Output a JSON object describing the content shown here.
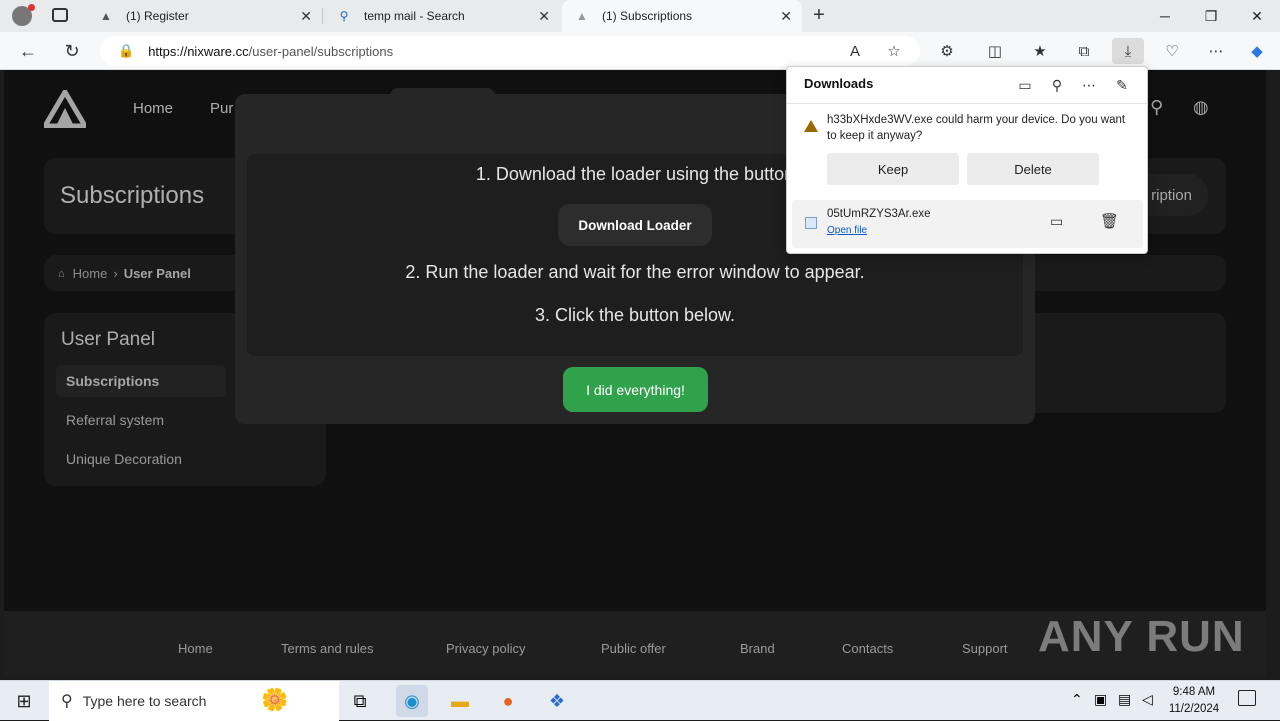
{
  "browser": {
    "tabs": [
      {
        "label": "(1) Register",
        "icon": "nixware-logo-icon"
      },
      {
        "label": "temp mail - Search",
        "icon": "search-icon"
      },
      {
        "label": "(1) Subscriptions",
        "icon": "nixware-logo-icon",
        "active": true
      }
    ],
    "url_host": "https://nixware.cc",
    "url_path": "/user-panel/subscriptions"
  },
  "site": {
    "nav": [
      "Home",
      "Pur"
    ],
    "page_title": "Subscriptions",
    "right_button_partial": "ription",
    "breadcrumb": {
      "home": "Home",
      "current": "User Panel"
    },
    "sidebar": {
      "title": "User Panel",
      "items": [
        "Subscriptions",
        "Referral system",
        "Unique Decoration"
      ]
    },
    "footer": [
      "Home",
      "Terms and rules",
      "Privacy policy",
      "Public offer",
      "Brand",
      "Contacts",
      "Support"
    ]
  },
  "modal": {
    "step1": "1. Download the loader using the button",
    "download_button": "Download Loader",
    "step2": "2. Run the loader and wait for the error window to appear.",
    "step3": "3. Click the button below.",
    "done_button": "I did everything!"
  },
  "downloads": {
    "title": "Downloads",
    "warning": "h33bXHxde3WV.exe could harm your device. Do you want to keep it anyway?",
    "keep": "Keep",
    "delete": "Delete",
    "file_name": "05tUmRZYS3Ar.exe",
    "open_file": "Open file"
  },
  "watermark": "ANY RUN",
  "taskbar": {
    "search_placeholder": "Type here to search",
    "time": "9:48 AM",
    "date": "11/2/2024"
  },
  "colors": {
    "accent_green": "#31a24c",
    "page_bg": "#161616",
    "warning": "#9a6700"
  }
}
